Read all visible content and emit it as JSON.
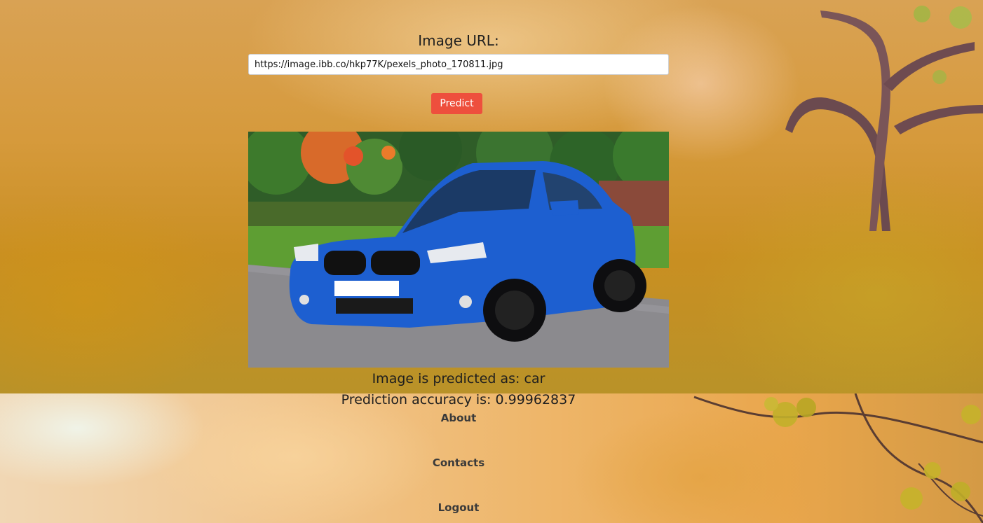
{
  "form": {
    "label": "Image URL:",
    "url_value": "https://image.ibb.co/hkp77K/pexels_photo_170811.jpg",
    "predict_label": "Predict"
  },
  "preview": {
    "subject": "blue-car-photo"
  },
  "result": {
    "class_text": "Image is predicted as: car",
    "accuracy_text": "Prediction accuracy is: 0.99962837"
  },
  "nav": {
    "about": "About",
    "contacts": "Contacts",
    "logout": "Logout"
  },
  "colors": {
    "predict_button": "#ee4f3d",
    "car_body": "#1d5fd0"
  }
}
